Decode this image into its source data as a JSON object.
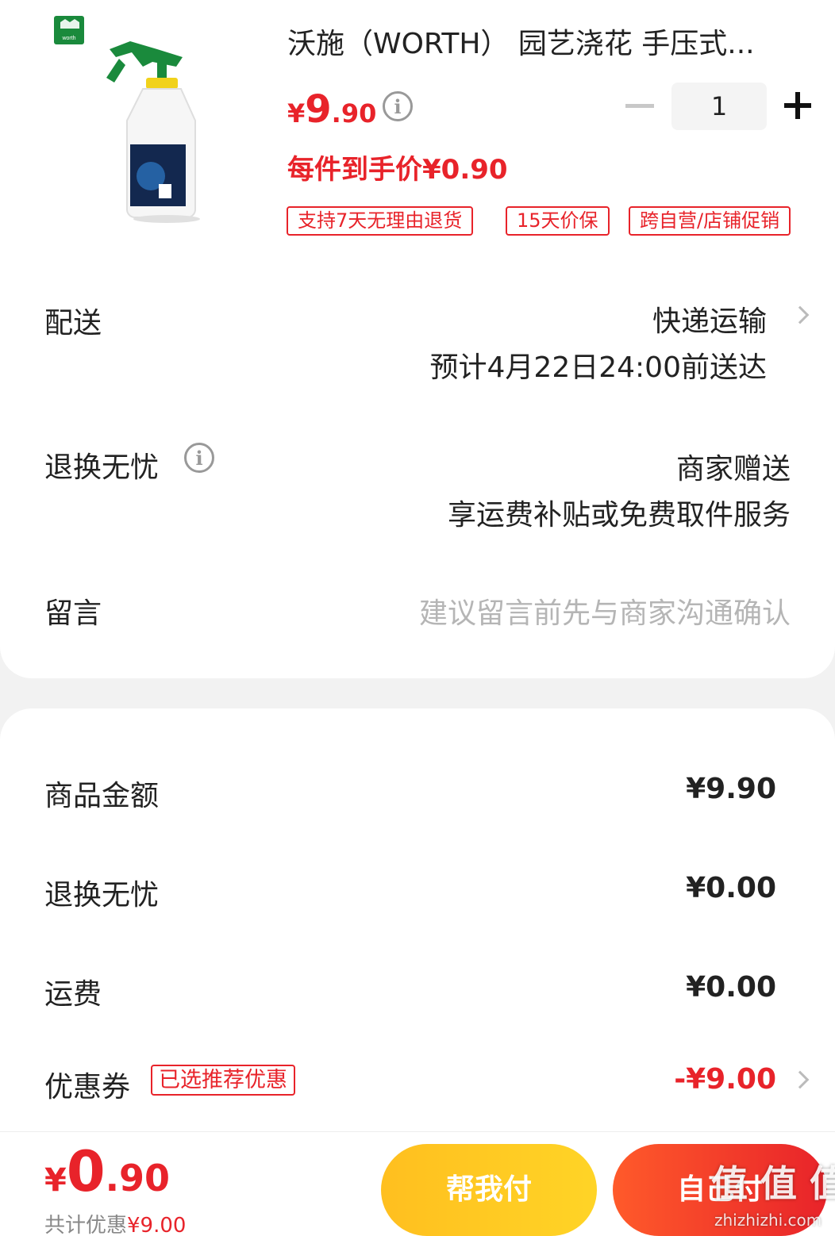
{
  "product": {
    "title": "沃施（WORTH） 园艺浇花 手压式...",
    "price_symbol": "¥",
    "price_int": "9",
    "price_dec": ".90",
    "quantity": "1",
    "unit_price": "每件到手价¥0.90",
    "tags": [
      "支持7天无理由退货",
      "15天价保",
      "跨自营/店铺促销"
    ],
    "logo_text": "worth"
  },
  "delivery": {
    "label": "配送",
    "method": "快递运输",
    "eta": "预计4月22日24:00前送达"
  },
  "returns": {
    "label": "退换无忧",
    "value": "商家赠送",
    "desc": "享运费补贴或免费取件服务"
  },
  "message": {
    "label": "留言",
    "placeholder": "建议留言前先与商家沟通确认"
  },
  "summary": {
    "goods_label": "商品金额",
    "goods_value": "¥9.90",
    "returns_label": "退换无忧",
    "returns_value": "¥0.00",
    "shipping_label": "运费",
    "shipping_value": "¥0.00",
    "coupon_label": "优惠券",
    "coupon_tag": "已选推荐优惠",
    "coupon_value": "-¥9.00"
  },
  "footer": {
    "total_symbol": "¥",
    "total_int": "0",
    "total_dec": ".90",
    "discount_label": "共计优惠",
    "discount_value": "¥9.00",
    "help_pay": "帮我付",
    "self_pay": "自己付",
    "watermark": "值 值 值",
    "watermark_url": "zhizhizhi.com"
  },
  "colors": {
    "accent_red": "#e8232a",
    "help_pay_yellow": "#ffc21f",
    "brand_green": "#1a8a3c"
  }
}
